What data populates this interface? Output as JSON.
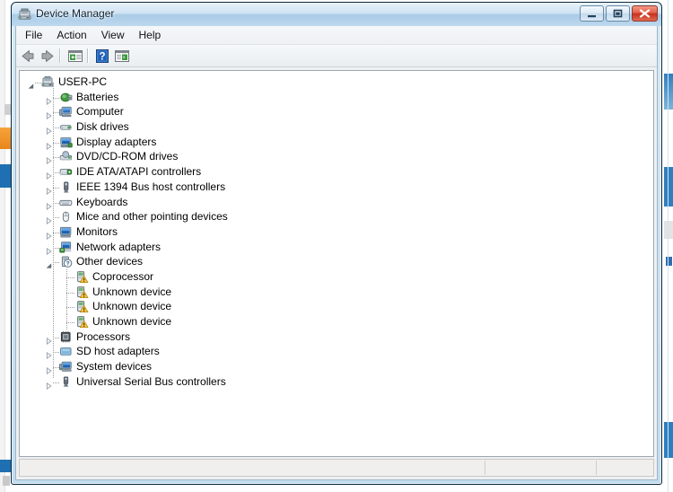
{
  "window": {
    "title": "Device Manager",
    "title_icon": "device-manager-icon",
    "controls": {
      "minimize": "Minimize",
      "maximize": "Maximize",
      "close": "Close"
    }
  },
  "menu": {
    "items": [
      {
        "label": "File",
        "name": "menu-file"
      },
      {
        "label": "Action",
        "name": "menu-action"
      },
      {
        "label": "View",
        "name": "menu-view"
      },
      {
        "label": "Help",
        "name": "menu-help"
      }
    ]
  },
  "toolbar": {
    "buttons": [
      {
        "name": "back-button",
        "icon": "back-arrow-icon",
        "tooltip": "Back"
      },
      {
        "name": "forward-button",
        "icon": "forward-arrow-icon",
        "tooltip": "Forward"
      },
      {
        "name": "properties-button",
        "icon": "properties-icon",
        "tooltip": "Properties"
      },
      {
        "name": "help-button",
        "icon": "help-question-icon",
        "tooltip": "Help"
      },
      {
        "name": "show-hide-console-tree-button",
        "icon": "console-tree-icon",
        "tooltip": "Show/Hide Console Tree"
      }
    ]
  },
  "tree": {
    "root": {
      "label": "USER-PC",
      "icon": "computer-root-icon",
      "expanded": true
    },
    "items": [
      {
        "label": "Batteries",
        "icon": "battery-icon",
        "expandable": true,
        "expanded": false,
        "level": 1
      },
      {
        "label": "Computer",
        "icon": "computer-icon",
        "expandable": true,
        "expanded": false,
        "level": 1
      },
      {
        "label": "Disk drives",
        "icon": "disk-drive-icon",
        "expandable": true,
        "expanded": false,
        "level": 1
      },
      {
        "label": "Display adapters",
        "icon": "display-adapter-icon",
        "expandable": true,
        "expanded": false,
        "level": 1
      },
      {
        "label": "DVD/CD-ROM drives",
        "icon": "dvd-drive-icon",
        "expandable": true,
        "expanded": false,
        "level": 1
      },
      {
        "label": "IDE ATA/ATAPI controllers",
        "icon": "ide-controller-icon",
        "expandable": true,
        "expanded": false,
        "level": 1
      },
      {
        "label": "IEEE 1394 Bus host controllers",
        "icon": "ieee1394-icon",
        "expandable": true,
        "expanded": false,
        "level": 1
      },
      {
        "label": "Keyboards",
        "icon": "keyboard-icon",
        "expandable": true,
        "expanded": false,
        "level": 1
      },
      {
        "label": "Mice and other pointing devices",
        "icon": "mouse-icon",
        "expandable": true,
        "expanded": false,
        "level": 1
      },
      {
        "label": "Monitors",
        "icon": "monitor-icon",
        "expandable": true,
        "expanded": false,
        "level": 1
      },
      {
        "label": "Network adapters",
        "icon": "network-adapter-icon",
        "expandable": true,
        "expanded": false,
        "level": 1
      },
      {
        "label": "Other devices",
        "icon": "other-devices-icon",
        "expandable": true,
        "expanded": true,
        "level": 1
      },
      {
        "label": "Coprocessor",
        "icon": "unknown-device-warning-icon",
        "expandable": false,
        "expanded": false,
        "level": 2
      },
      {
        "label": "Unknown device",
        "icon": "unknown-device-warning-icon",
        "expandable": false,
        "expanded": false,
        "level": 2
      },
      {
        "label": "Unknown device",
        "icon": "unknown-device-warning-icon",
        "expandable": false,
        "expanded": false,
        "level": 2
      },
      {
        "label": "Unknown device",
        "icon": "unknown-device-warning-icon",
        "expandable": false,
        "expanded": false,
        "level": 2
      },
      {
        "label": "Processors",
        "icon": "processor-icon",
        "expandable": true,
        "expanded": false,
        "level": 1
      },
      {
        "label": "SD host adapters",
        "icon": "sd-host-adapter-icon",
        "expandable": true,
        "expanded": false,
        "level": 1
      },
      {
        "label": "System devices",
        "icon": "system-device-icon",
        "expandable": true,
        "expanded": false,
        "level": 1
      },
      {
        "label": "Universal Serial Bus controllers",
        "icon": "usb-controller-icon",
        "expandable": true,
        "expanded": false,
        "level": 1
      }
    ]
  },
  "statusbar": {
    "panes": [
      "",
      "",
      ""
    ]
  },
  "colors": {
    "titlebar_accent": "#a9cbe6",
    "close_button": "#c7301c",
    "warning_badge": "#f5c243",
    "window_border": "#0c2a3e",
    "tree_background": "#ffffff"
  }
}
